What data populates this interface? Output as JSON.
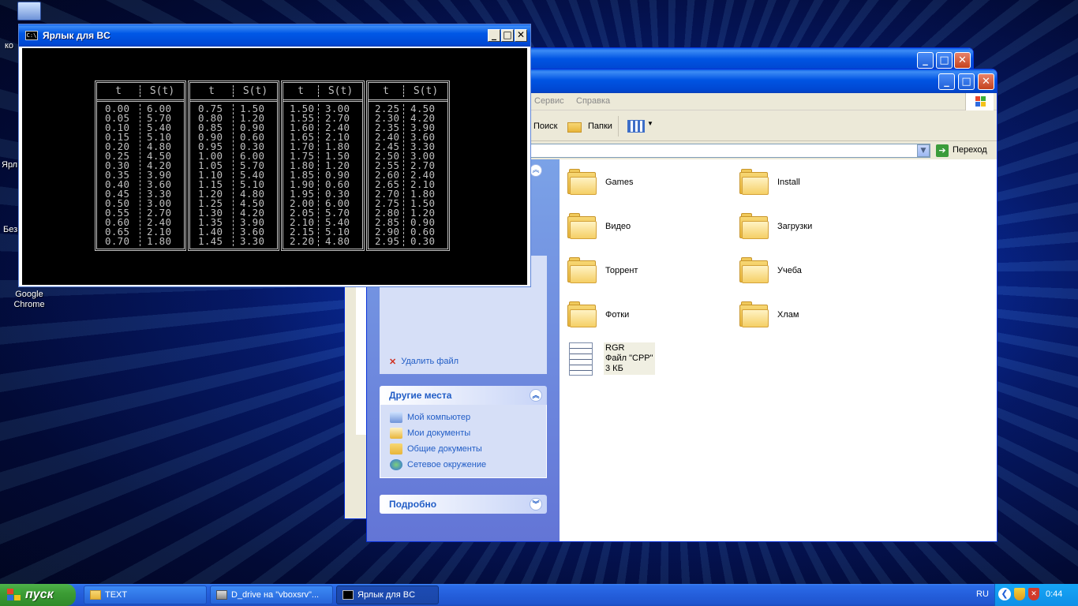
{
  "desktop": {
    "labels": {
      "my_computer_partial": "ко",
      "shortcut_partial": "Ярл",
      "untitled_partial": "Без",
      "chrome_line1": "Google",
      "chrome_line2": "Chrome"
    }
  },
  "console": {
    "title": "Ярлык для BC",
    "icon_text": "C:\\",
    "header_t": "t",
    "header_s": "S(t)",
    "blocks": [
      {
        "t": [
          "0.00",
          "0.05",
          "0.10",
          "0.15",
          "0.20",
          "0.25",
          "0.30",
          "0.35",
          "0.40",
          "0.45",
          "0.50",
          "0.55",
          "0.60",
          "0.65",
          "0.70"
        ],
        "s": [
          "6.00",
          "5.70",
          "5.40",
          "5.10",
          "4.80",
          "4.50",
          "4.20",
          "3.90",
          "3.60",
          "3.30",
          "3.00",
          "2.70",
          "2.40",
          "2.10",
          "1.80"
        ]
      },
      {
        "t": [
          "0.75",
          "0.80",
          "0.85",
          "0.90",
          "0.95",
          "1.00",
          "1.05",
          "1.10",
          "1.15",
          "1.20",
          "1.25",
          "1.30",
          "1.35",
          "1.40",
          "1.45"
        ],
        "s": [
          "1.50",
          "1.20",
          "0.90",
          "0.60",
          "0.30",
          "6.00",
          "5.70",
          "5.40",
          "5.10",
          "4.80",
          "4.50",
          "4.20",
          "3.90",
          "3.60",
          "3.30"
        ]
      },
      {
        "t": [
          "1.50",
          "1.55",
          "1.60",
          "1.65",
          "1.70",
          "1.75",
          "1.80",
          "1.85",
          "1.90",
          "1.95",
          "2.00",
          "2.05",
          "2.10",
          "2.15",
          "2.20"
        ],
        "s": [
          "3.00",
          "2.70",
          "2.40",
          "2.10",
          "1.80",
          "1.50",
          "1.20",
          "0.90",
          "0.60",
          "0.30",
          "6.00",
          "5.70",
          "5.40",
          "5.10",
          "4.80"
        ]
      },
      {
        "t": [
          "2.25",
          "2.30",
          "2.35",
          "2.40",
          "2.45",
          "2.50",
          "2.55",
          "2.60",
          "2.65",
          "2.70",
          "2.75",
          "2.80",
          "2.85",
          "2.90",
          "2.95"
        ],
        "s": [
          "4.50",
          "4.20",
          "3.90",
          "3.60",
          "3.30",
          "3.00",
          "2.70",
          "2.40",
          "2.10",
          "1.80",
          "1.50",
          "1.20",
          "0.90",
          "0.60",
          "0.30"
        ]
      }
    ]
  },
  "explorer": {
    "menu": {
      "service": "Сервис",
      "help": "Справка"
    },
    "toolbar": {
      "search": "Поиск",
      "folders": "Папки"
    },
    "address": {
      "go": "Переход"
    },
    "tasks": {
      "delete_file": "Удалить файл",
      "other_places": {
        "title": "Другие места",
        "links": [
          "Мой компьютер",
          "Мои документы",
          "Общие документы",
          "Сетевое окружение"
        ]
      },
      "details": {
        "title": "Подробно"
      }
    },
    "items": {
      "folders": [
        "Games",
        "Install",
        "Видео",
        "Загрузки",
        "Торрент",
        "Учеба",
        "Фотки",
        "Хлам"
      ],
      "file": {
        "name": "RGR",
        "type": "Файл \"CPP\"",
        "size": "3 КБ"
      }
    }
  },
  "taskbar": {
    "start": "пуск",
    "tasks": [
      "TEXT",
      "D_drive на \"vboxsrv\"...",
      "Ярлык для BC"
    ],
    "lang": "RU",
    "clock": "0:44"
  },
  "colors": {
    "xp_blue": "#0054e3",
    "task_link": "#215dc6",
    "start_green": "#3c9d35",
    "console_text": "#c0c0c0"
  }
}
